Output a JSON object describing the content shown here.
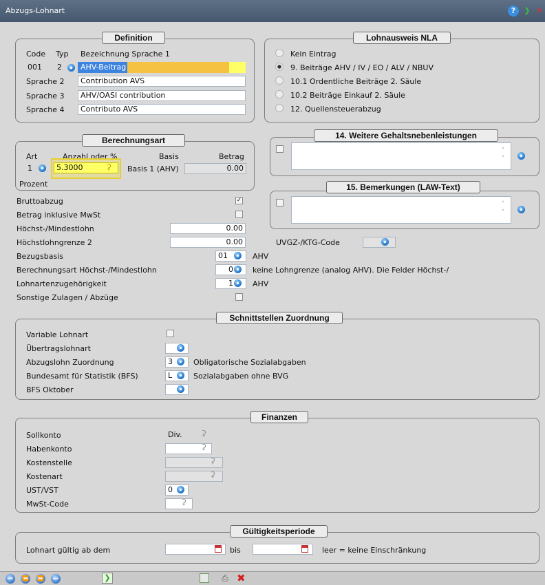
{
  "window": {
    "title": "Abzugs-Lohnart"
  },
  "definition": {
    "legend": "Definition",
    "header": {
      "code": "Code",
      "typ": "Typ",
      "bez": "Bezeichnung Sprache 1"
    },
    "code": "001",
    "typ": "2",
    "sprache1": "AHV-Beitrag",
    "rows": [
      {
        "label": "Sprache 2",
        "value": "Contribution AVS"
      },
      {
        "label": "Sprache 3",
        "value": "AHV/OASI contribution"
      },
      {
        "label": "Sprache 4",
        "value": "Contributo AVS"
      }
    ]
  },
  "lohnausweis": {
    "legend": "Lohnausweis NLA",
    "options": [
      "Kein Eintrag",
      "9. Beiträge AHV / IV / EO / ALV  / NBUV",
      "10.1 Ordentliche Beiträge 2. Säule",
      "10.2 Beiträge Einkauf 2. Säule",
      "12. Quellensteuerabzug"
    ],
    "selected_index": 1
  },
  "berechnungsart": {
    "legend": "Berechnungsart",
    "header": {
      "art": "Art",
      "anzahl": "Anzahl oder %",
      "basis": "Basis",
      "betrag": "Betrag"
    },
    "art": "1",
    "anzahl": "5.3000",
    "basis": "Basis 1 (AHV)",
    "betrag": "0.00",
    "type_label": "Prozent"
  },
  "weitere": {
    "legend": "14. Weitere Gehaltsnebenleistungen"
  },
  "bemerkungen": {
    "legend": "15. Bemerkungen (LAW-Text)"
  },
  "settings": {
    "bruttoabzug": "Bruttoabzug",
    "mwst": "Betrag inklusive MwSt",
    "hoechst": "Höchst-/Mindestlohn",
    "hoechst_val": "0.00",
    "hoechst2": "Höchstlohngrenze 2",
    "hoechst2_val": "0.00",
    "bezugsbasis": "Bezugsbasis",
    "bezugsbasis_val": "01",
    "bezugsbasis_desc": "AHV",
    "berechnungsart_hm": "Berechnungsart Höchst-/Mindestlohn",
    "berechnungsart_hm_val": "0",
    "berechnungsart_hm_desc": "keine Lohngrenze (analog AHV). Die Felder Höchst-/",
    "zugehoerigkeit": "Lohnartenzugehörigkeit",
    "zugehoerigkeit_val": "1",
    "zugehoerigkeit_desc": "AHV",
    "sonstige": "Sonstige Zulagen / Abzüge",
    "uvgz": "UVGZ-/KTG-Code"
  },
  "schnittstellen": {
    "legend": "Schnittstellen Zuordnung",
    "variable": "Variable Lohnart",
    "uebertrag": "Übertragslohnart",
    "abzugslohn": "Abzugslohn Zuordnung",
    "abzugslohn_val": "3",
    "abzugslohn_desc": "Obligatorische Sozialabgaben",
    "bfs": "Bundesamt für Statistik (BFS)",
    "bfs_val": "L",
    "bfs_desc": "Sozialabgaben ohne BVG",
    "bfs_oktober": "BFS Oktober"
  },
  "finanzen": {
    "legend": "Finanzen",
    "soll": "Sollkonto",
    "soll_val": "Div.",
    "haben": "Habenkonto",
    "kostenstelle": "Kostenstelle",
    "kostenart": "Kostenart",
    "ust": "UST/VST",
    "ust_val": "0",
    "mwst": "MwSt-Code"
  },
  "gueltigkeit": {
    "legend": "Gültigkeitsperiode",
    "label": "Lohnart gültig ab dem",
    "bis": "bis",
    "hint": "leer = keine Einschränkung"
  },
  "colors": {
    "titlebar": "#4f6277",
    "highlight": "#f5c242",
    "selection": "#3d83e0",
    "yellow_field": "#ffff66"
  }
}
